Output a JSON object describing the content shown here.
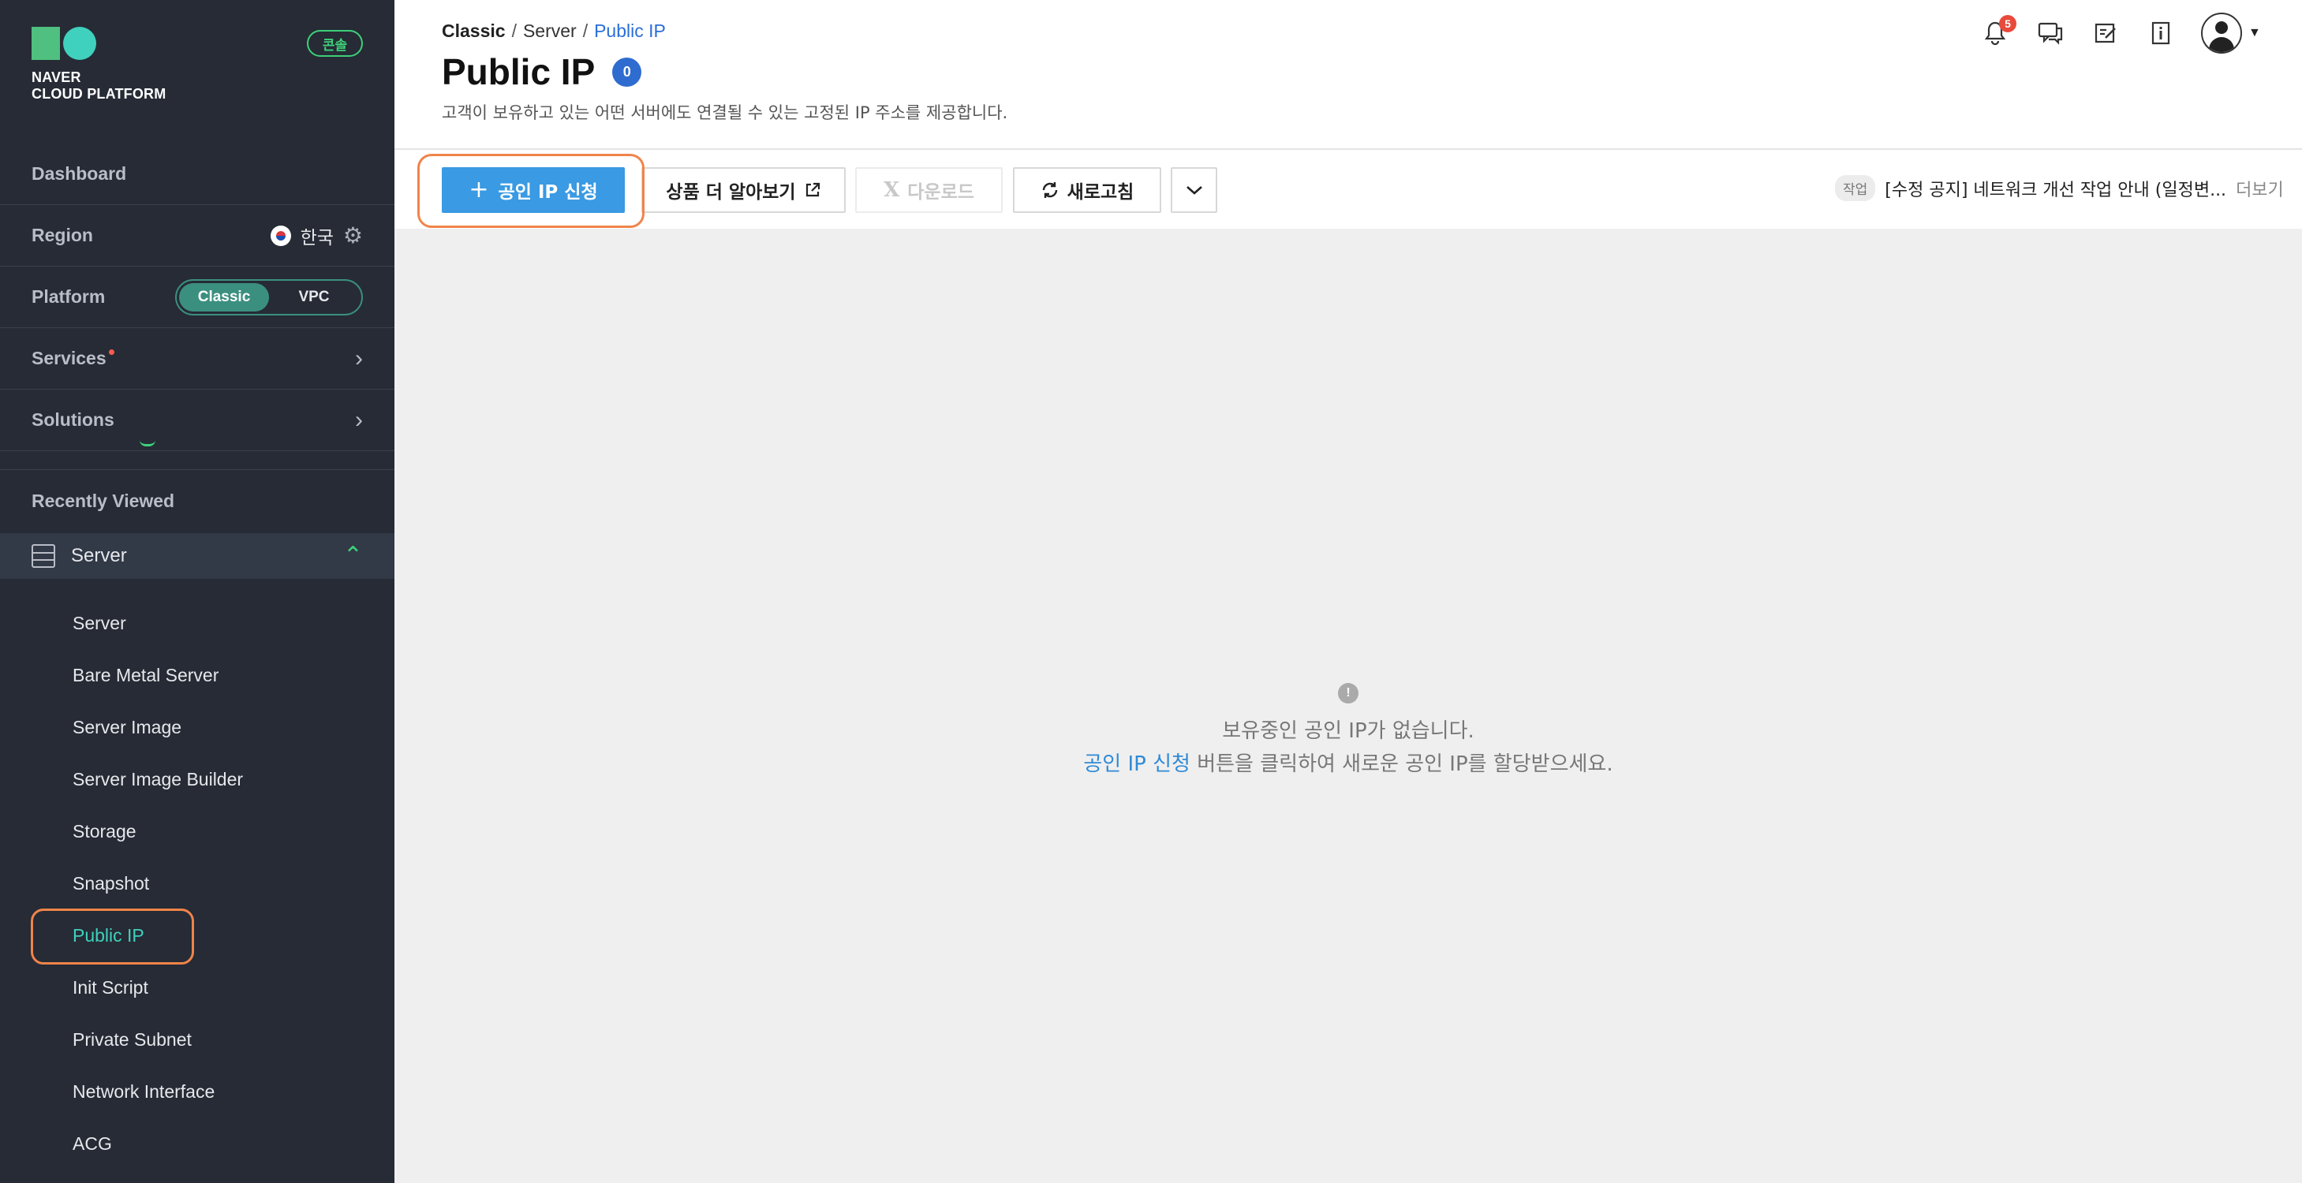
{
  "sidebar": {
    "brand": {
      "line1": "NAVER",
      "line2": "CLOUD PLATFORM",
      "colors": {
        "square": "#4fc07f",
        "circle": "#3fd1bd"
      }
    },
    "console_badge": "콘솔",
    "dashboard": "Dashboard",
    "region": {
      "label": "Region",
      "value": "한국",
      "flag_icon": "korea-flag-icon",
      "settings_icon": "gear-icon"
    },
    "platform": {
      "label": "Platform",
      "options": [
        "Classic",
        "VPC"
      ],
      "selected": "Classic"
    },
    "services": {
      "label": "Services",
      "has_new_dot": true
    },
    "solutions": {
      "label": "Solutions"
    },
    "recently_viewed": "Recently Viewed",
    "group": {
      "label": "Server",
      "expanded": true
    },
    "items": [
      "Server",
      "Bare Metal Server",
      "Server Image",
      "Server Image Builder",
      "Storage",
      "Snapshot",
      "Public IP",
      "Init Script",
      "Private Subnet",
      "Network Interface",
      "ACG"
    ],
    "active_item": "Public IP"
  },
  "header": {
    "breadcrumb": [
      "Classic",
      "Server",
      "Public IP"
    ],
    "title": "Public IP",
    "count": "0",
    "description": "고객이 보유하고 있는 어떤 서버에도 연결될 수 있는 고정된 IP 주소를 제공합니다.",
    "notification_count": "5"
  },
  "toolbar": {
    "apply": "공인 IP 신청",
    "learn_more": "상품 더 알아보기",
    "download": "다운로드",
    "refresh": "새로고침"
  },
  "notice": {
    "tag": "작업",
    "text": "[수정 공지] 네트워크 개선 작업 안내 (일정변...",
    "more": "더보기"
  },
  "empty_state": {
    "line1": "보유중인 공인 IP가 없습니다.",
    "link": "공인 IP 신청",
    "line2_rest": " 버튼을 클릭하여 새로운 공인 IP를 할당받으세요."
  },
  "colors": {
    "sidebar_bg": "#262b35",
    "accent_teal": "#3fd1bd",
    "primary_button": "#3a9ae3",
    "highlight_outline": "#f0844a",
    "badge_blue": "#2f6cd0"
  }
}
